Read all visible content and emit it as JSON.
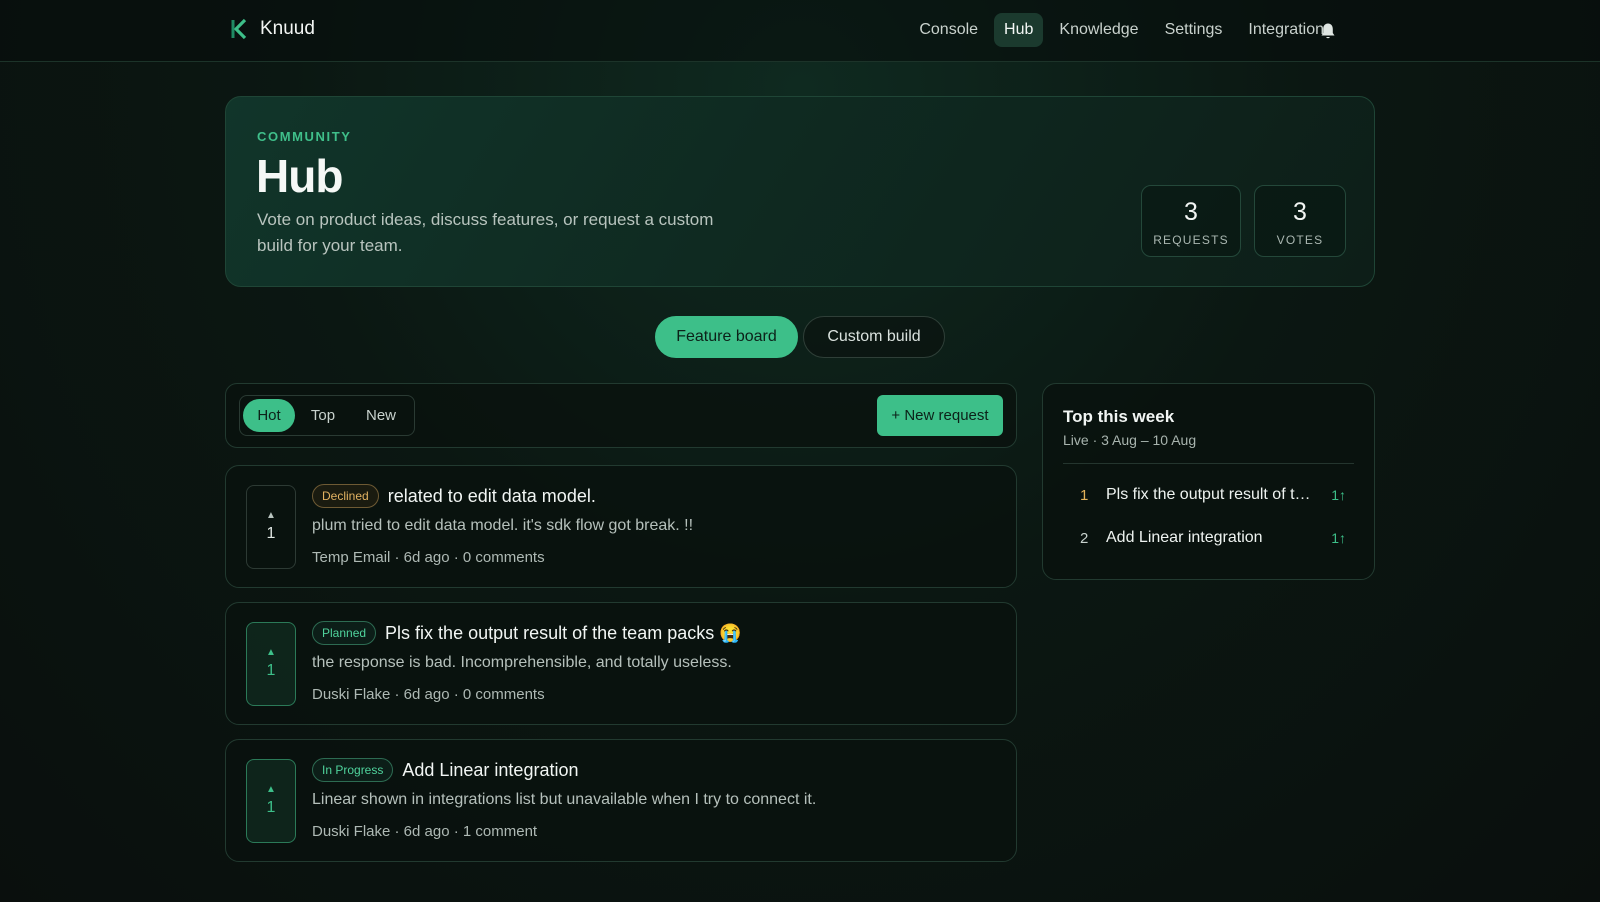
{
  "brand": {
    "name": "Knuud"
  },
  "nav": {
    "items": [
      {
        "label": "Console",
        "active": false
      },
      {
        "label": "Hub",
        "active": true
      },
      {
        "label": "Knowledge",
        "active": false
      },
      {
        "label": "Settings",
        "active": false
      },
      {
        "label": "Integrations",
        "active": false
      }
    ],
    "bell_icon": "bell-icon"
  },
  "hero": {
    "eyebrow": "COMMUNITY",
    "title": "Hub",
    "description": "Vote on product ideas, discuss features, or request a custom build for your team.",
    "stats": [
      {
        "value": "3",
        "label": "REQUESTS"
      },
      {
        "value": "3",
        "label": "VOTES"
      }
    ]
  },
  "modes": {
    "feature_board": "Feature board",
    "custom_build": "Custom build",
    "active": "Feature board"
  },
  "toolbar": {
    "sort_options": [
      "Hot",
      "Top",
      "New"
    ],
    "active_sort": "Hot",
    "new_request_label": "+ New request"
  },
  "requests": [
    {
      "votes": "1",
      "vote_arrow": "▲",
      "status": "Declined",
      "title": "related to edit data model.",
      "description": "plum tried to edit data model. it's sdk flow got break. !!",
      "meta": "Temp Email · 6d ago · 0 comments"
    },
    {
      "votes": "1",
      "vote_arrow": "▲",
      "status": "Planned",
      "title": "Pls fix the output result of the team packs 😭",
      "description": "the response is bad. Incomprehensible, and totally useless.",
      "meta": "Duski Flake · 6d ago · 0 comments"
    },
    {
      "votes": "1",
      "vote_arrow": "▲",
      "status": "In Progress",
      "title": "Add Linear integration",
      "description": "Linear shown in integrations list but unavailable when I try to connect it.",
      "meta": "Duski Flake · 6d ago · 1 comment"
    }
  ],
  "top_week": {
    "title": "Top this week",
    "subtitle": "Live · 3 Aug – 10 Aug",
    "items": [
      {
        "rank": "1",
        "title": "Pls fix the output result of th...",
        "votes": "1↑"
      },
      {
        "rank": "2",
        "title": "Add Linear integration",
        "votes": "1↑"
      }
    ]
  },
  "colors": {
    "accent": "#3dbf89",
    "declined": "#e2b262",
    "background": "#0a0f0d"
  }
}
